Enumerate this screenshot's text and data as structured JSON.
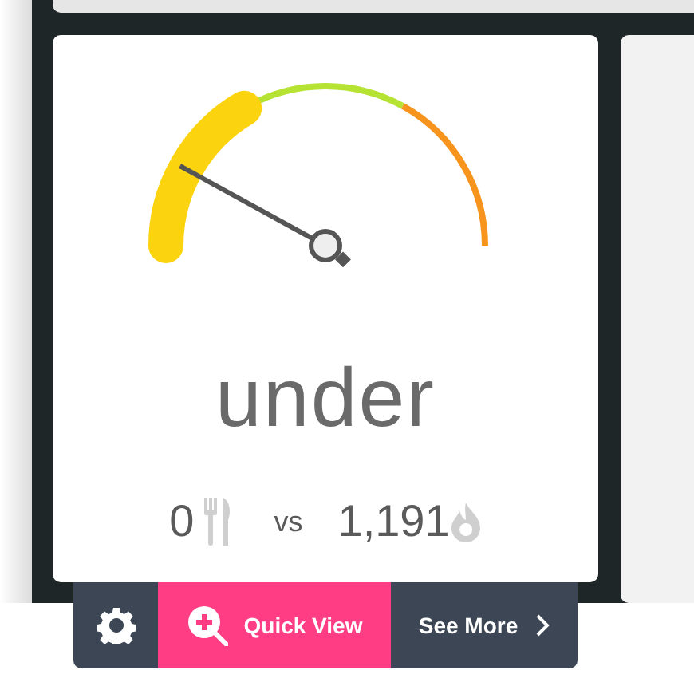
{
  "gauge": {
    "status": "under"
  },
  "comparison": {
    "eaten": "0",
    "separator": "vs",
    "burned": "1,191"
  },
  "toolbar": {
    "buttons": [
      {
        "kind": "settings"
      },
      {
        "kind": "quick",
        "label": "Quick View"
      },
      {
        "kind": "more",
        "label": "See More"
      }
    ]
  }
}
